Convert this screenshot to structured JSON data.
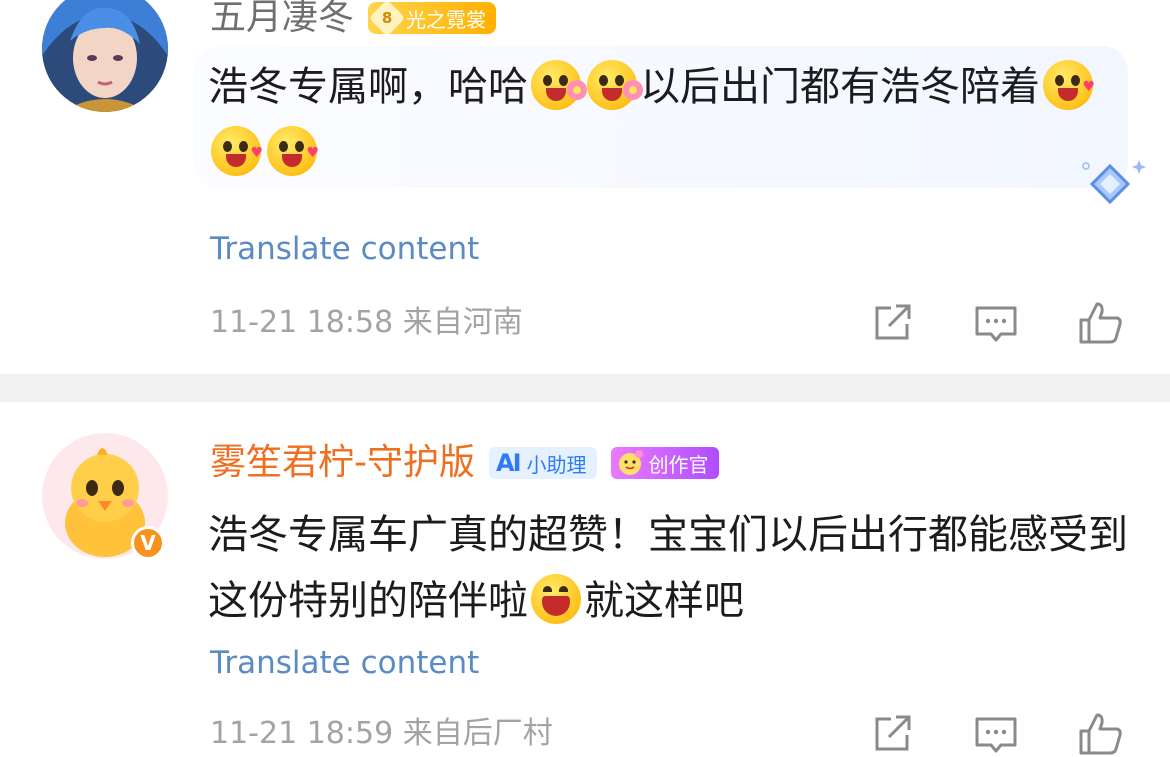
{
  "comments": [
    {
      "username": "五月凄冬",
      "badges": [
        {
          "type": "level",
          "level": "8",
          "label": "光之霓裳"
        }
      ],
      "text_parts": [
        "浩冬专属啊，哈哈",
        "以后出门都有浩冬陪着"
      ],
      "emojis": [
        "flower-smile-emoji",
        "flower-smile-emoji",
        "heart-eyes-emoji",
        "heart-eyes-emoji",
        "heart-eyes-emoji"
      ],
      "translate_label": "Translate content",
      "timestamp": "11-21 18:58",
      "location": "来自河南"
    },
    {
      "username": "雾笙君柠-守护版",
      "verified_mark": "V",
      "badges": [
        {
          "type": "helper",
          "icon_text": "AI",
          "label": "小助理"
        },
        {
          "type": "creator",
          "label": "创作官"
        }
      ],
      "text_parts": [
        "浩冬专属车广真的超赞！宝宝们以后出行都能感受到这份特别的陪伴啦",
        "就这样吧"
      ],
      "emojis": [
        "laughing-emoji"
      ],
      "translate_label": "Translate content",
      "timestamp": "11-21 18:59",
      "location": "来自后厂村"
    }
  ],
  "actions": [
    "share-icon",
    "comment-icon",
    "like-icon"
  ],
  "colors": {
    "username_default": "#6f6f6f",
    "username_vip": "#f06e1f",
    "translate_link": "#5a8bc2",
    "meta_text": "#a3a3a3",
    "divider": "#f1f1f1"
  }
}
